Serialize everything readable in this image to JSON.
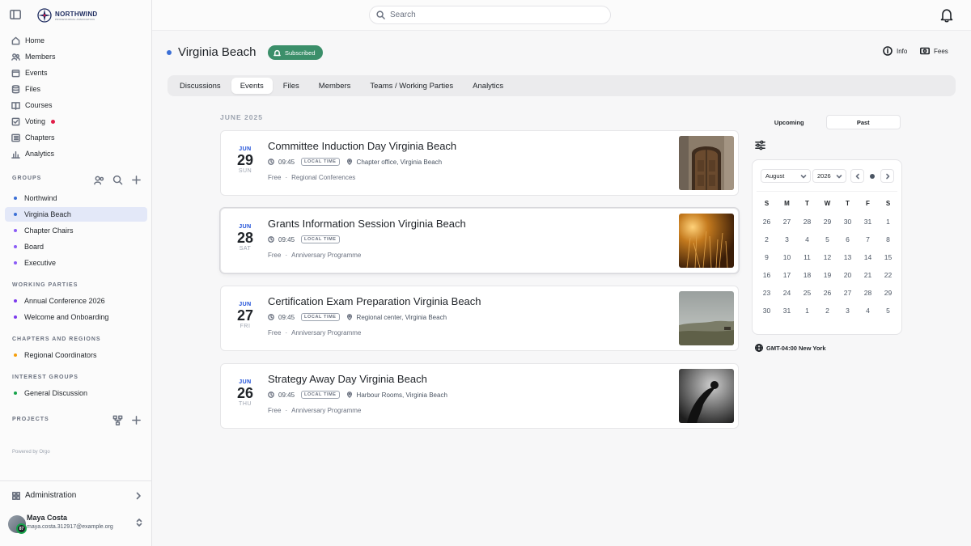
{
  "brand": {
    "name": "NORTHWIND",
    "tagline": "PROFESSIONAL ASSOCIATION"
  },
  "search": {
    "placeholder": "Search"
  },
  "nav": [
    {
      "label": "Home",
      "icon": "home-icon"
    },
    {
      "label": "Members",
      "icon": "members-icon"
    },
    {
      "label": "Events",
      "icon": "calendar-icon"
    },
    {
      "label": "Files",
      "icon": "database-icon"
    },
    {
      "label": "Courses",
      "icon": "book-icon"
    },
    {
      "label": "Voting",
      "icon": "ballot-icon",
      "badge_color": "#e11d48"
    },
    {
      "label": "Chapters",
      "icon": "chapters-icon"
    },
    {
      "label": "Analytics",
      "icon": "chart-icon"
    }
  ],
  "sections": {
    "groups": {
      "title": "GROUPS",
      "items": [
        {
          "label": "Northwind",
          "color": "#3b6fd6"
        },
        {
          "label": "Virginia Beach",
          "color": "#3b6fd6",
          "active": true
        },
        {
          "label": "Chapter Chairs",
          "color": "#8b5cf6"
        },
        {
          "label": "Board",
          "color": "#8b5cf6"
        },
        {
          "label": "Executive",
          "color": "#8b5cf6"
        }
      ]
    },
    "working_parties": {
      "title": "WORKING PARTIES",
      "items": [
        {
          "label": "Annual Conference 2026",
          "color": "#7c3aed"
        },
        {
          "label": "Welcome and Onboarding",
          "color": "#7c3aed"
        }
      ]
    },
    "chapters": {
      "title": "CHAPTERS AND REGIONS",
      "items": [
        {
          "label": "Regional Coordinators",
          "color": "#f59e0b"
        }
      ]
    },
    "interest": {
      "title": "INTEREST GROUPS",
      "items": [
        {
          "label": "General Discussion",
          "color": "#16a34a"
        }
      ]
    },
    "projects": {
      "title": "PROJECTS"
    }
  },
  "powered_by": "Powered by Orgo",
  "administration": "Administration",
  "user": {
    "name": "Maya Costa",
    "email": "maya.costa.312917@example.org",
    "badge": "87"
  },
  "group": {
    "name": "Virginia Beach",
    "subscribed_label": "Subscribed",
    "info_label": "Info",
    "fees_label": "Fees"
  },
  "tabs": [
    "Discussions",
    "Events",
    "Files",
    "Members",
    "Teams / Working Parties",
    "Analytics"
  ],
  "active_tab": "Events",
  "events_month": "JUNE 2025",
  "events": [
    {
      "mon": "JUN",
      "day": "29",
      "dow": "SUN",
      "title": "Committee Induction Day Virginia Beach",
      "time": "09:45",
      "tz_pill": "LOCAL TIME",
      "location": "Chapter office, Virginia Beach",
      "price": "Free",
      "category": "Regional Conferences",
      "image": "wooden-door-photo"
    },
    {
      "mon": "JUN",
      "day": "28",
      "dow": "SAT",
      "title": "Grants Information Session Virginia Beach",
      "time": "09:45",
      "tz_pill": "LOCAL TIME",
      "location": "",
      "price": "Free",
      "category": "Anniversary Programme",
      "image": "golden-grass-photo"
    },
    {
      "mon": "JUN",
      "day": "27",
      "dow": "FRI",
      "title": "Certification Exam Preparation Virginia Beach",
      "time": "09:45",
      "tz_pill": "LOCAL TIME",
      "location": "Regional center, Virginia Beach",
      "price": "Free",
      "category": "Anniversary Programme",
      "image": "misty-field-photo"
    },
    {
      "mon": "JUN",
      "day": "26",
      "dow": "THU",
      "title": "Strategy Away Day Virginia Beach",
      "time": "09:45",
      "tz_pill": "LOCAL TIME",
      "location": "Harbour Rooms, Virginia Beach",
      "price": "Free",
      "category": "Anniversary Programme",
      "image": "monochrome-figure-photo"
    }
  ],
  "panel": {
    "toggle": [
      "Upcoming",
      "Past"
    ],
    "selected_toggle": "Past",
    "month": "August",
    "year": "2026",
    "weekdays": [
      "S",
      "M",
      "T",
      "W",
      "T",
      "F",
      "S"
    ],
    "days": [
      "26",
      "27",
      "28",
      "29",
      "30",
      "31",
      "1",
      "2",
      "3",
      "4",
      "5",
      "6",
      "7",
      "8",
      "9",
      "10",
      "11",
      "12",
      "13",
      "14",
      "15",
      "16",
      "17",
      "18",
      "19",
      "20",
      "21",
      "22",
      "23",
      "24",
      "25",
      "26",
      "27",
      "28",
      "29",
      "30",
      "31",
      "1",
      "2",
      "3",
      "4",
      "5"
    ],
    "timezone": "GMT-04:00 New York"
  }
}
